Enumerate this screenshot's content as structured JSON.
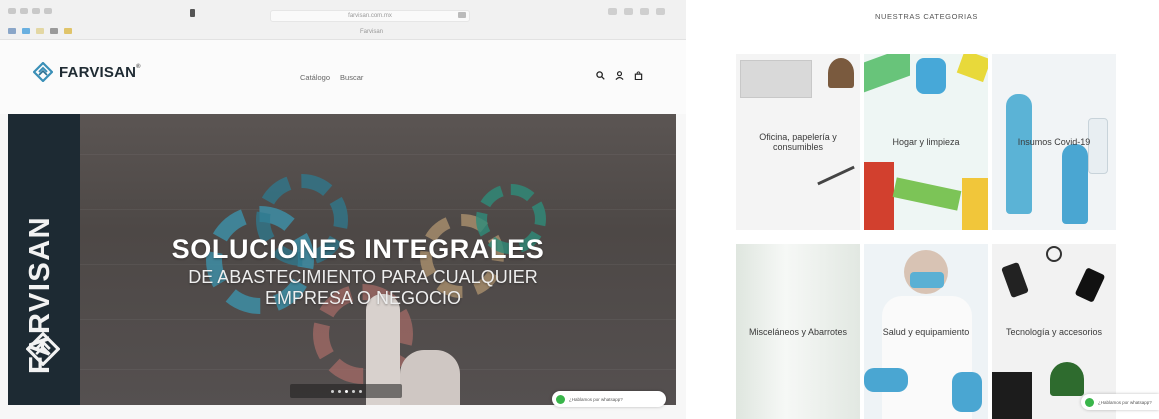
{
  "browser": {
    "url": "farvisan.com.mx",
    "tab_title": "Farvisan"
  },
  "site": {
    "logo_text": "FARVISAN",
    "logo_reg": "®",
    "nav": [
      {
        "label": "Catálogo"
      },
      {
        "label": "Buscar"
      }
    ],
    "header_icons": [
      "search-icon",
      "user-icon",
      "cart-icon"
    ]
  },
  "hero": {
    "brand_vertical": "FARVISAN",
    "title": "SOLUCIONES INTEGRALES",
    "subtitle_line1": "DE ABASTECIMIENTO PARA CUALQUIER",
    "subtitle_line2": "EMPRESA O NEGOCIO",
    "slides_total": 5,
    "slide_active": 3
  },
  "whatsapp": {
    "label": "¿Hablamos por whatsapp?",
    "color": "#39b54a"
  },
  "categories": {
    "title": "NUESTRAS CATEGORIAS",
    "items": [
      {
        "label": "Oficina, papelería y consumibles"
      },
      {
        "label": "Hogar y limpieza"
      },
      {
        "label": "Insumos Covid-19"
      },
      {
        "label": "Misceláneos y Abarrotes"
      },
      {
        "label": "Salud y equipamiento"
      },
      {
        "label": "Tecnología y accesorios"
      }
    ]
  },
  "colors": {
    "brand_dark": "#1d2a33",
    "brand_teal": "#3a8fb7",
    "hero_bg": "#514b49",
    "accent_green": "#39b54a"
  }
}
